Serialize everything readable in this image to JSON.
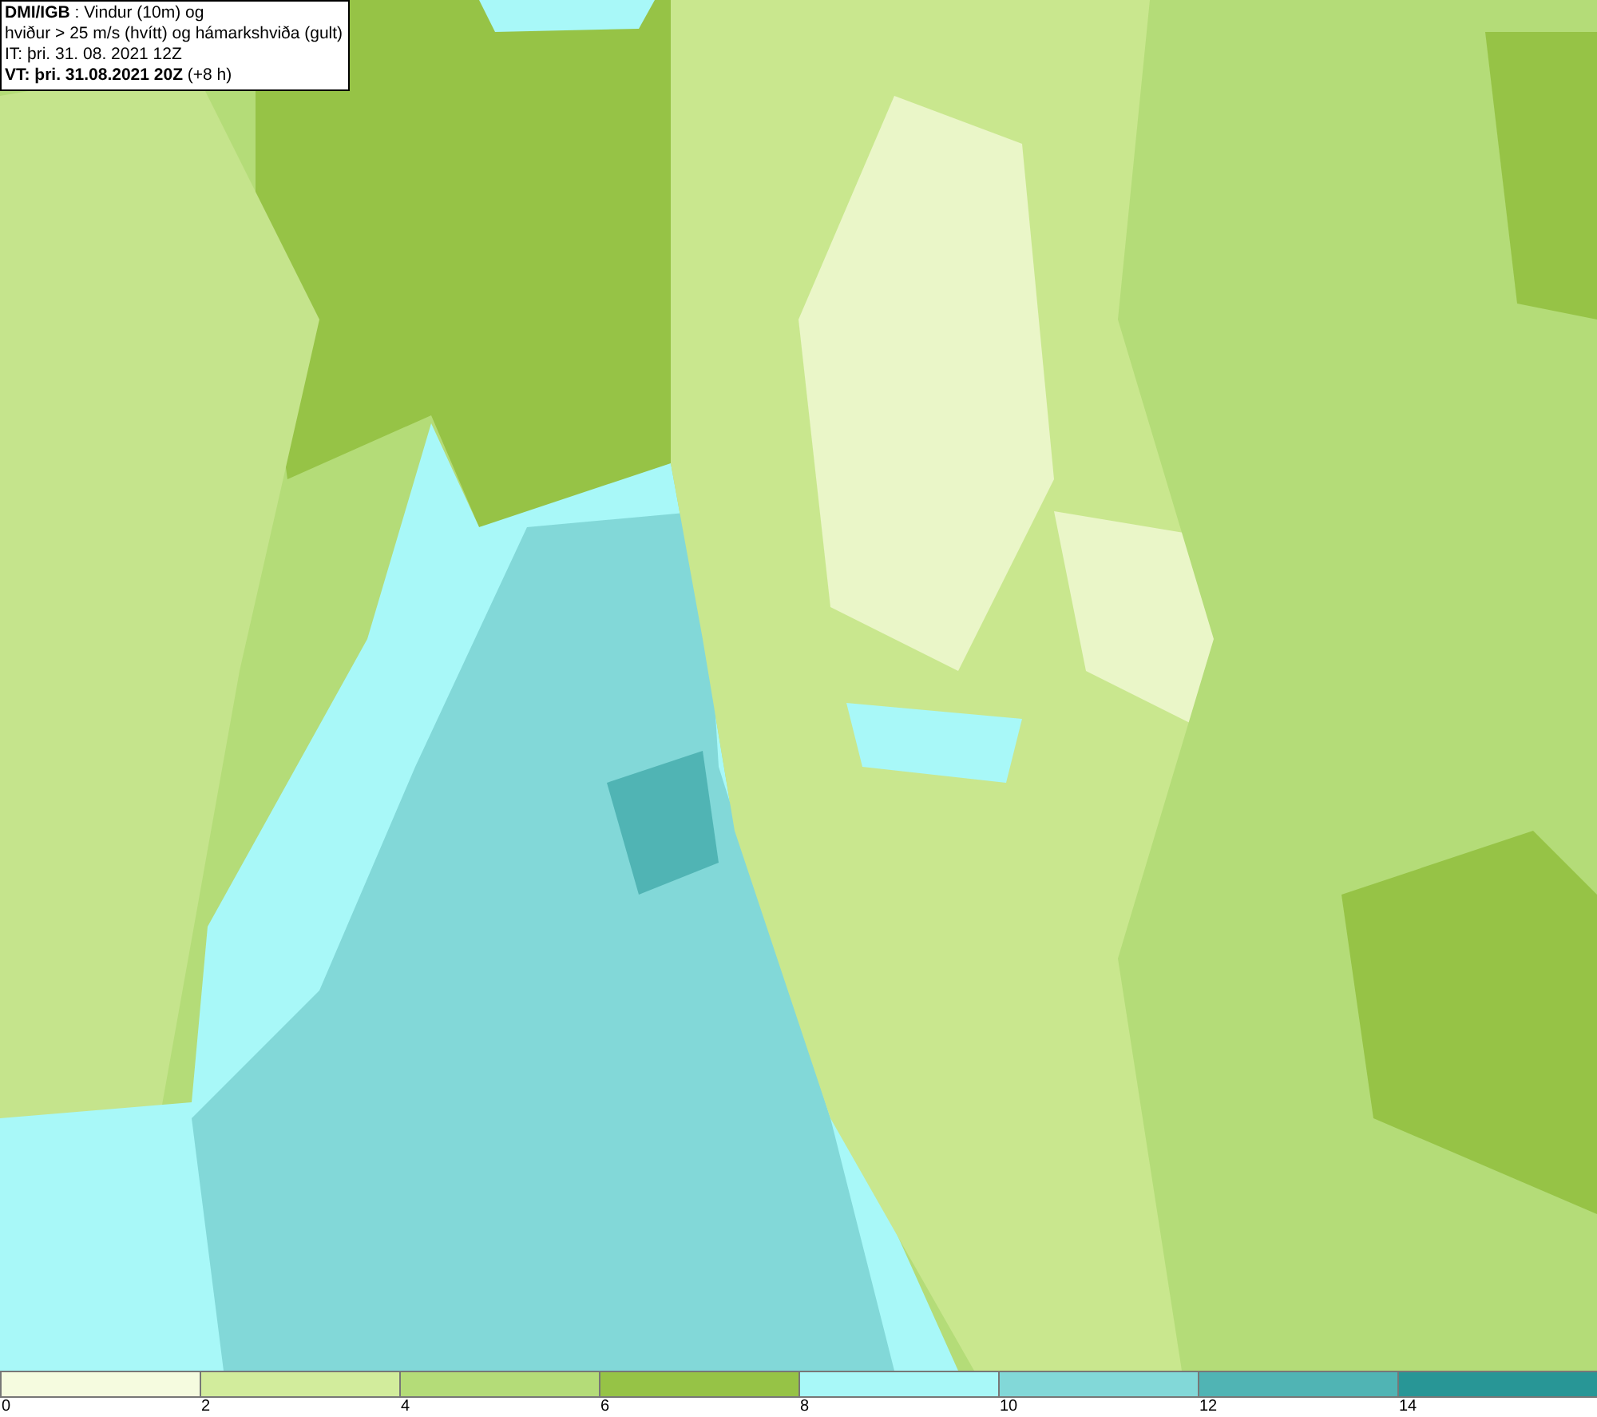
{
  "header": {
    "lines": [
      "**DMI/IGB** : Vindur (10m) og",
      "hviður > 25 m/s (hvítt) og hámarkshviða (gult)",
      "IT: þri. 31. 08. 2021 12Z",
      "**VT: þri. 31.08.2021 20Z** (+8 h)"
    ]
  },
  "legend": {
    "swatches": [
      {
        "color": "#f5fbdf"
      },
      {
        "color": "#d2ec9c"
      },
      {
        "color": "#b4dc78"
      },
      {
        "color": "#96c346"
      },
      {
        "color": "#a8f8f8"
      },
      {
        "color": "#82d8d8"
      },
      {
        "color": "#50b4b4"
      },
      {
        "color": "#289696"
      }
    ],
    "ticks": [
      "0",
      "2",
      "4",
      "6",
      "8",
      "10",
      "12",
      "14"
    ]
  }
}
